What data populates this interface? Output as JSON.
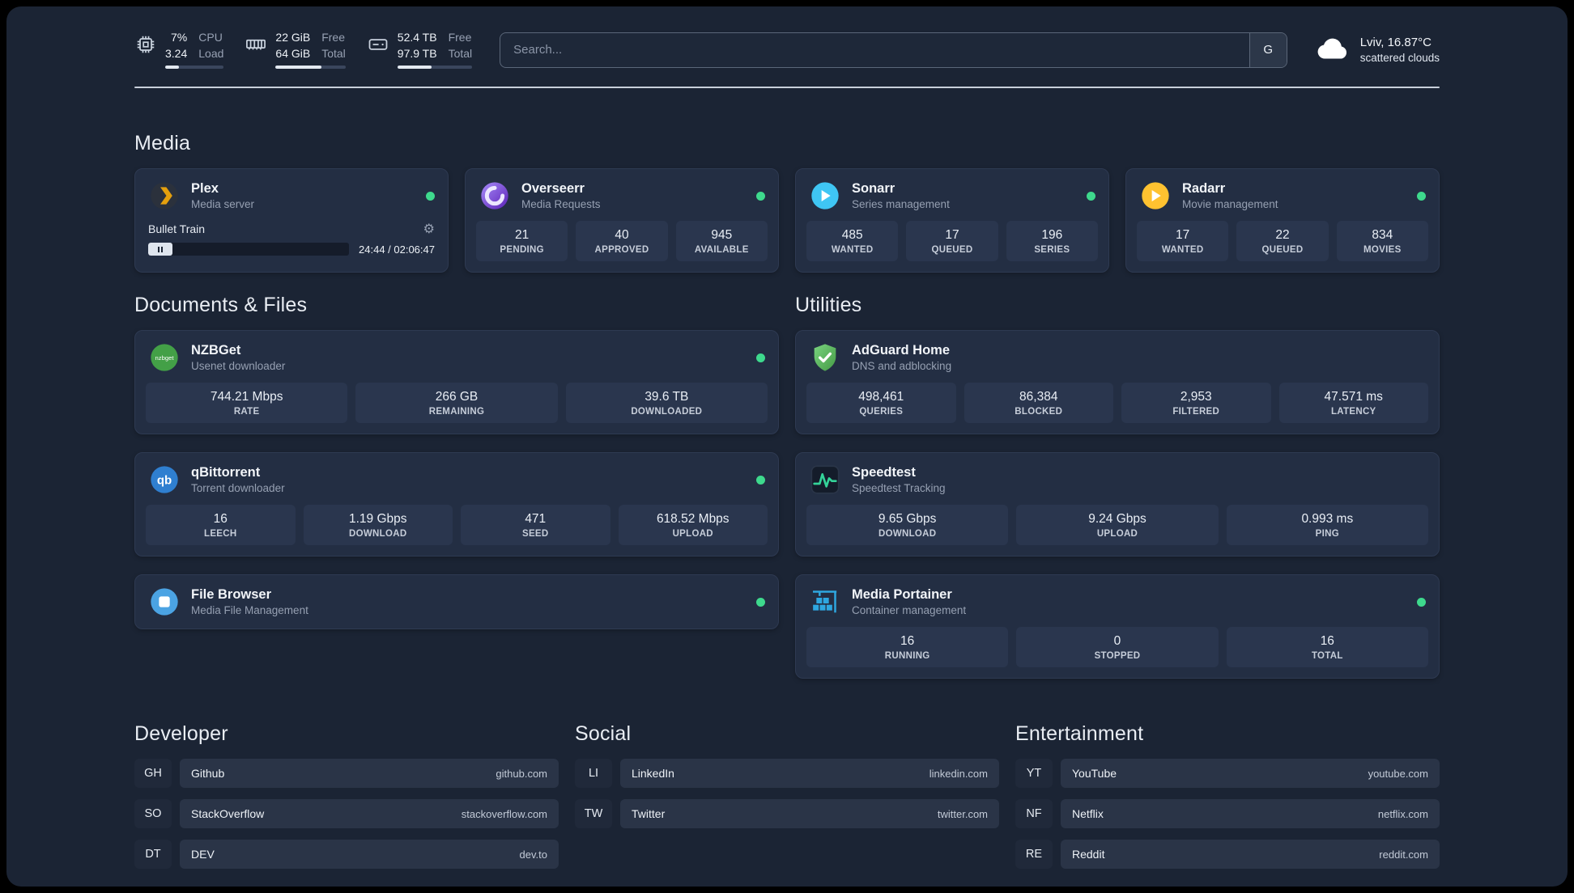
{
  "topbar": {
    "cpu": {
      "value1": "7%",
      "label1": "CPU",
      "value2": "3.24",
      "label2": "Load",
      "percent": 24
    },
    "ram": {
      "value1": "22 GiB",
      "label1": "Free",
      "value2": "64 GiB",
      "label2": "Total",
      "percent": 66
    },
    "disk": {
      "value1": "52.4 TB",
      "label1": "Free",
      "value2": "97.9 TB",
      "label2": "Total",
      "percent": 46
    },
    "search": {
      "placeholder": "Search...",
      "engine_button": "G"
    },
    "weather": {
      "location": "Lviv, 16.87°C",
      "condition": "scattered clouds"
    }
  },
  "sections": {
    "media": {
      "title": "Media",
      "plex": {
        "title": "Plex",
        "subtitle": "Media server",
        "now_playing": "Bullet Train",
        "time": "24:44 / 02:06:47"
      },
      "overseerr": {
        "title": "Overseerr",
        "subtitle": "Media Requests",
        "stats": [
          {
            "value": "21",
            "label": "PENDING"
          },
          {
            "value": "40",
            "label": "APPROVED"
          },
          {
            "value": "945",
            "label": "AVAILABLE"
          }
        ]
      },
      "sonarr": {
        "title": "Sonarr",
        "subtitle": "Series management",
        "stats": [
          {
            "value": "485",
            "label": "WANTED"
          },
          {
            "value": "17",
            "label": "QUEUED"
          },
          {
            "value": "196",
            "label": "SERIES"
          }
        ]
      },
      "radarr": {
        "title": "Radarr",
        "subtitle": "Movie management",
        "stats": [
          {
            "value": "17",
            "label": "WANTED"
          },
          {
            "value": "22",
            "label": "QUEUED"
          },
          {
            "value": "834",
            "label": "MOVIES"
          }
        ]
      }
    },
    "documents": {
      "title": "Documents & Files",
      "nzbget": {
        "title": "NZBGet",
        "subtitle": "Usenet downloader",
        "stats": [
          {
            "value": "744.21 Mbps",
            "label": "RATE"
          },
          {
            "value": "266 GB",
            "label": "REMAINING"
          },
          {
            "value": "39.6 TB",
            "label": "DOWNLOADED"
          }
        ]
      },
      "qbittorrent": {
        "title": "qBittorrent",
        "subtitle": "Torrent downloader",
        "stats": [
          {
            "value": "16",
            "label": "LEECH"
          },
          {
            "value": "1.19 Gbps",
            "label": "DOWNLOAD"
          },
          {
            "value": "471",
            "label": "SEED"
          },
          {
            "value": "618.52 Mbps",
            "label": "UPLOAD"
          }
        ]
      },
      "filebrowser": {
        "title": "File Browser",
        "subtitle": "Media File Management"
      }
    },
    "utilities": {
      "title": "Utilities",
      "adguard": {
        "title": "AdGuard Home",
        "subtitle": "DNS and adblocking",
        "stats": [
          {
            "value": "498,461",
            "label": "QUERIES"
          },
          {
            "value": "86,384",
            "label": "BLOCKED"
          },
          {
            "value": "2,953",
            "label": "FILTERED"
          },
          {
            "value": "47.571 ms",
            "label": "LATENCY"
          }
        ]
      },
      "speedtest": {
        "title": "Speedtest",
        "subtitle": "Speedtest Tracking",
        "stats": [
          {
            "value": "9.65 Gbps",
            "label": "DOWNLOAD"
          },
          {
            "value": "9.24 Gbps",
            "label": "UPLOAD"
          },
          {
            "value": "0.993 ms",
            "label": "PING"
          }
        ]
      },
      "portainer": {
        "title": "Media Portainer",
        "subtitle": "Container management",
        "stats": [
          {
            "value": "16",
            "label": "RUNNING"
          },
          {
            "value": "0",
            "label": "STOPPED"
          },
          {
            "value": "16",
            "label": "TOTAL"
          }
        ]
      }
    },
    "bookmarks": [
      {
        "title": "Developer",
        "links": [
          {
            "abbr": "GH",
            "name": "Github",
            "url": "github.com"
          },
          {
            "abbr": "SO",
            "name": "StackOverflow",
            "url": "stackoverflow.com"
          },
          {
            "abbr": "DT",
            "name": "DEV",
            "url": "dev.to"
          }
        ]
      },
      {
        "title": "Social",
        "links": [
          {
            "abbr": "LI",
            "name": "LinkedIn",
            "url": "linkedin.com"
          },
          {
            "abbr": "TW",
            "name": "Twitter",
            "url": "twitter.com"
          }
        ]
      },
      {
        "title": "Entertainment",
        "links": [
          {
            "abbr": "YT",
            "name": "YouTube",
            "url": "youtube.com"
          },
          {
            "abbr": "NF",
            "name": "Netflix",
            "url": "netflix.com"
          },
          {
            "abbr": "RE",
            "name": "Reddit",
            "url": "reddit.com"
          }
        ]
      }
    ]
  }
}
